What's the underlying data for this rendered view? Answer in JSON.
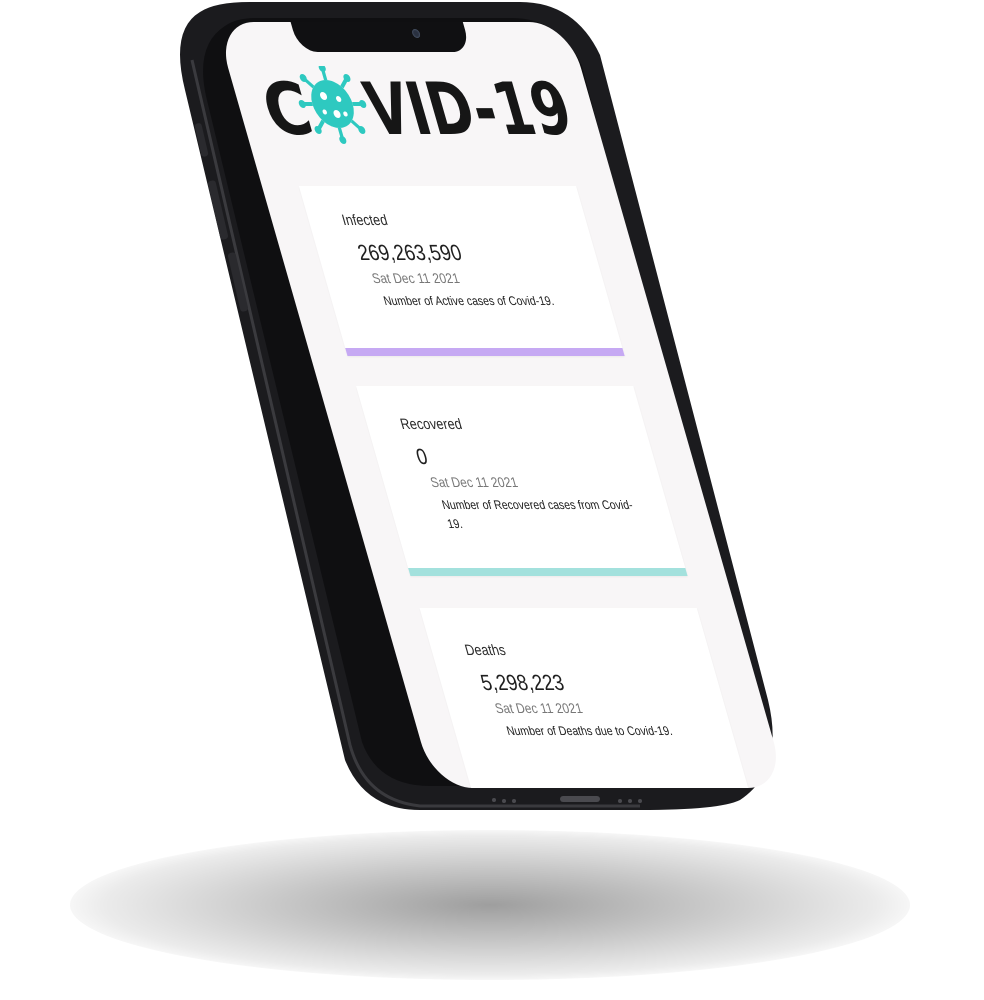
{
  "app": {
    "logo_text_left": "C",
    "logo_text_right": "VID-19",
    "logo_virus_color": "#2ec9c0",
    "logo_text_color": "#161616"
  },
  "cards": [
    {
      "id": "infected",
      "title": "Infected",
      "value": "269,263,590",
      "date": "Sat Dec 11 2021",
      "description": "Number of Active cases of Covid-19.",
      "accent_color": "#c6a9f3"
    },
    {
      "id": "recovered",
      "title": "Recovered",
      "value": "0",
      "date": "Sat Dec 11 2021",
      "description": "Number of Recovered cases from Covid-19.",
      "accent_color": "#a3e1dd"
    },
    {
      "id": "deaths",
      "title": "Deaths",
      "value": "5,298,223",
      "date": "Sat Dec 11 2021",
      "description": "Number of Deaths due to Covid-19.",
      "accent_color": "#f2a3a3"
    }
  ]
}
